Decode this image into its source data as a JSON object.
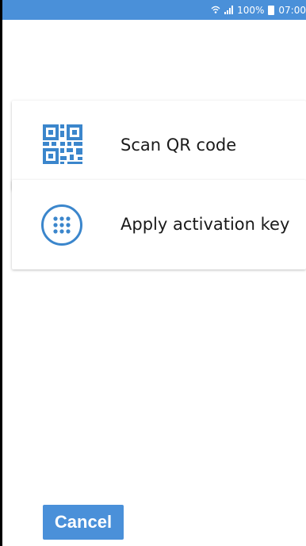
{
  "status_bar": {
    "signal_text": "100%",
    "time": "07:00",
    "wifi_icon": "wifi-icon",
    "signal_icon": "cell-signal-icon",
    "battery_icon": "battery-icon"
  },
  "options": [
    {
      "label": "Scan QR code",
      "icon": "qr-code-icon"
    },
    {
      "label": "Apply activation key",
      "icon": "keypad-icon"
    }
  ],
  "footer": {
    "cancel_label": "Cancel"
  },
  "colors": {
    "accent": "#4a90d9",
    "icon": "#3b86cc",
    "background": "#ffffff",
    "text": "#1a1a1a"
  }
}
